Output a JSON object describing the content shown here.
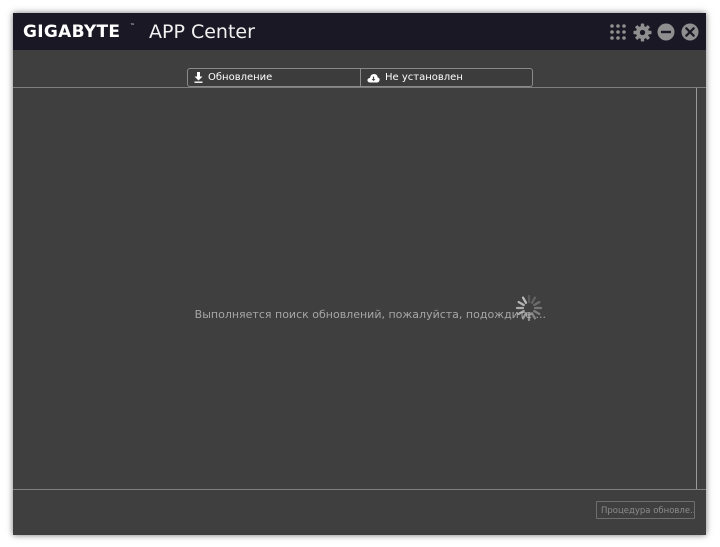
{
  "window": {
    "brand": "GIGABYTE",
    "brand_tm": "™",
    "title": "APP Center"
  },
  "title_controls": [
    {
      "name": "apps-grid-icon"
    },
    {
      "name": "gear-icon"
    },
    {
      "name": "minimize-icon"
    },
    {
      "name": "close-icon"
    }
  ],
  "tabs": [
    {
      "label": "Обновление",
      "icon": "download-icon"
    },
    {
      "label": "Не установлен",
      "icon": "cloud-download-icon"
    }
  ],
  "main": {
    "status_text": "Выполняется поиск обновлений, пожалуйста, подождите ...",
    "spinner_icon": "loading-spinner-icon"
  },
  "footer": {
    "update_procedure_label": "Процедура обновле..."
  },
  "colors": {
    "titlebar": "#1a1824",
    "background": "#3f3f3f",
    "controls": "#8f8f8f"
  }
}
